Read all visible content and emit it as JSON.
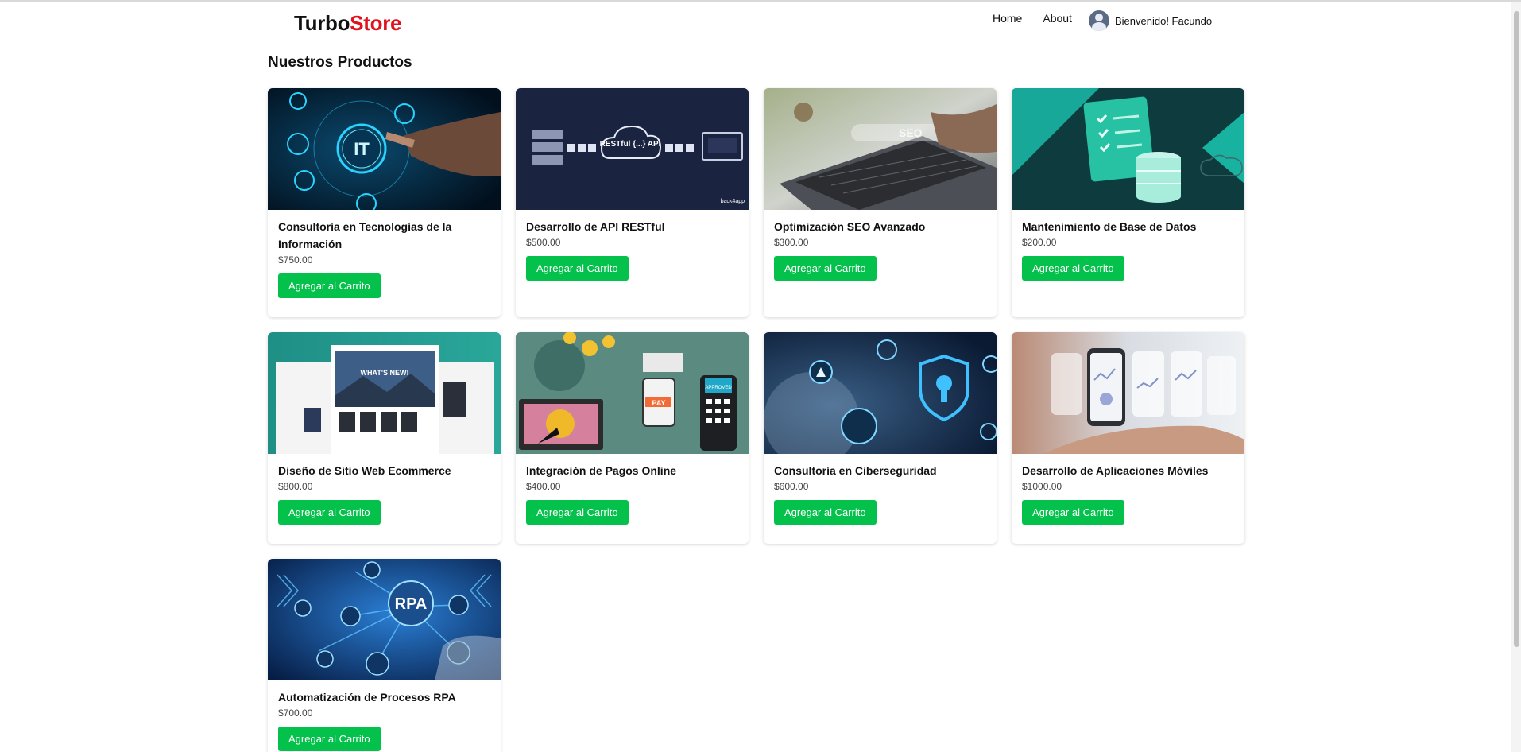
{
  "brand": {
    "part1": "Turbo",
    "part2": "Store"
  },
  "nav": {
    "home": "Home",
    "about": "About",
    "welcome": "Bienvenido! Facundo"
  },
  "page": {
    "title": "Nuestros Productos"
  },
  "button_label": "Agregar al Carrito",
  "products": [
    {
      "name": "Consultoría en Tecnologías de la Información",
      "price": "$750.00",
      "image_caption": "IT"
    },
    {
      "name": "Desarrollo de API RESTful",
      "price": "$500.00",
      "image_caption": "RESTful {...} API",
      "image_tag": "back4app"
    },
    {
      "name": "Optimización SEO Avanzado",
      "price": "$300.00",
      "image_caption": "SEO"
    },
    {
      "name": "Mantenimiento de Base de Datos",
      "price": "$200.00"
    },
    {
      "name": "Diseño de Sitio Web Ecommerce",
      "price": "$800.00",
      "image_caption": "WHAT'S NEW!"
    },
    {
      "name": "Integración de Pagos Online",
      "price": "$400.00",
      "image_caption": "PAY",
      "image_tag": "APPROVED"
    },
    {
      "name": "Consultoría en Ciberseguridad",
      "price": "$600.00"
    },
    {
      "name": "Desarrollo de Aplicaciones Móviles",
      "price": "$1000.00"
    },
    {
      "name": "Automatización de Procesos RPA",
      "price": "$700.00",
      "image_caption": "RPA"
    }
  ],
  "colors": {
    "brand_red": "#e0121b",
    "button_green": "#04c14b"
  }
}
